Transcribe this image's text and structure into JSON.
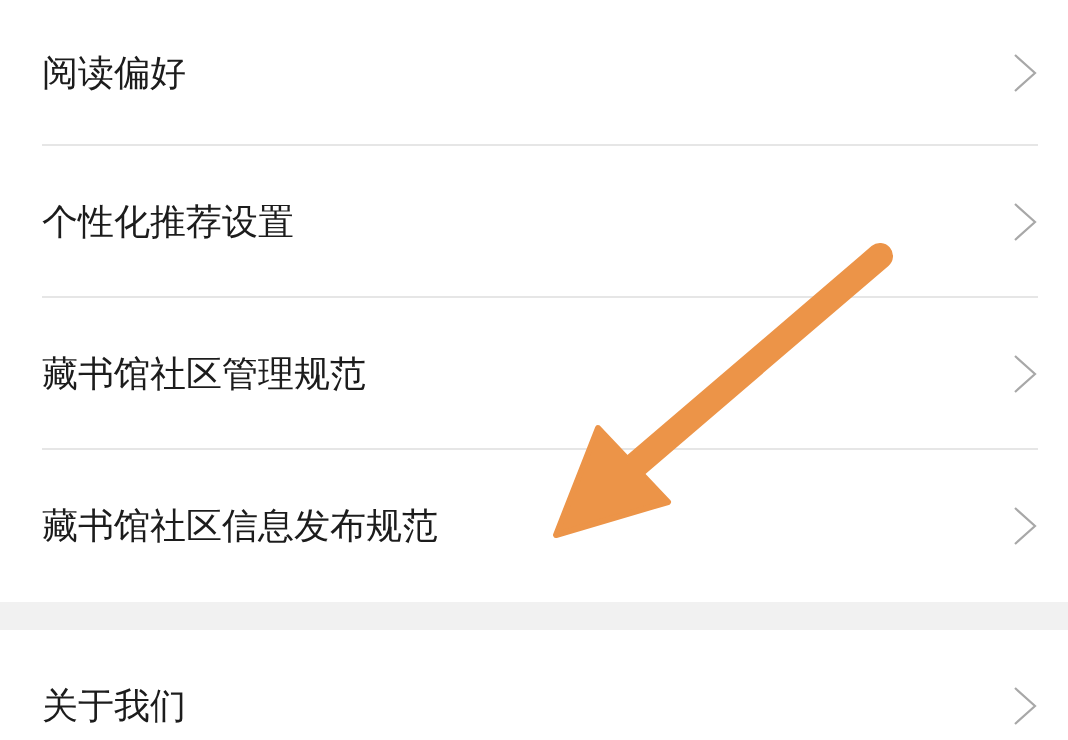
{
  "groups": [
    {
      "items": [
        {
          "label": "阅读偏好"
        },
        {
          "label": "个性化推荐设置"
        },
        {
          "label": "藏书馆社区管理规范"
        },
        {
          "label": "藏书馆社区信息发布规范"
        }
      ]
    },
    {
      "items": [
        {
          "label": "关于我们"
        }
      ]
    }
  ]
}
